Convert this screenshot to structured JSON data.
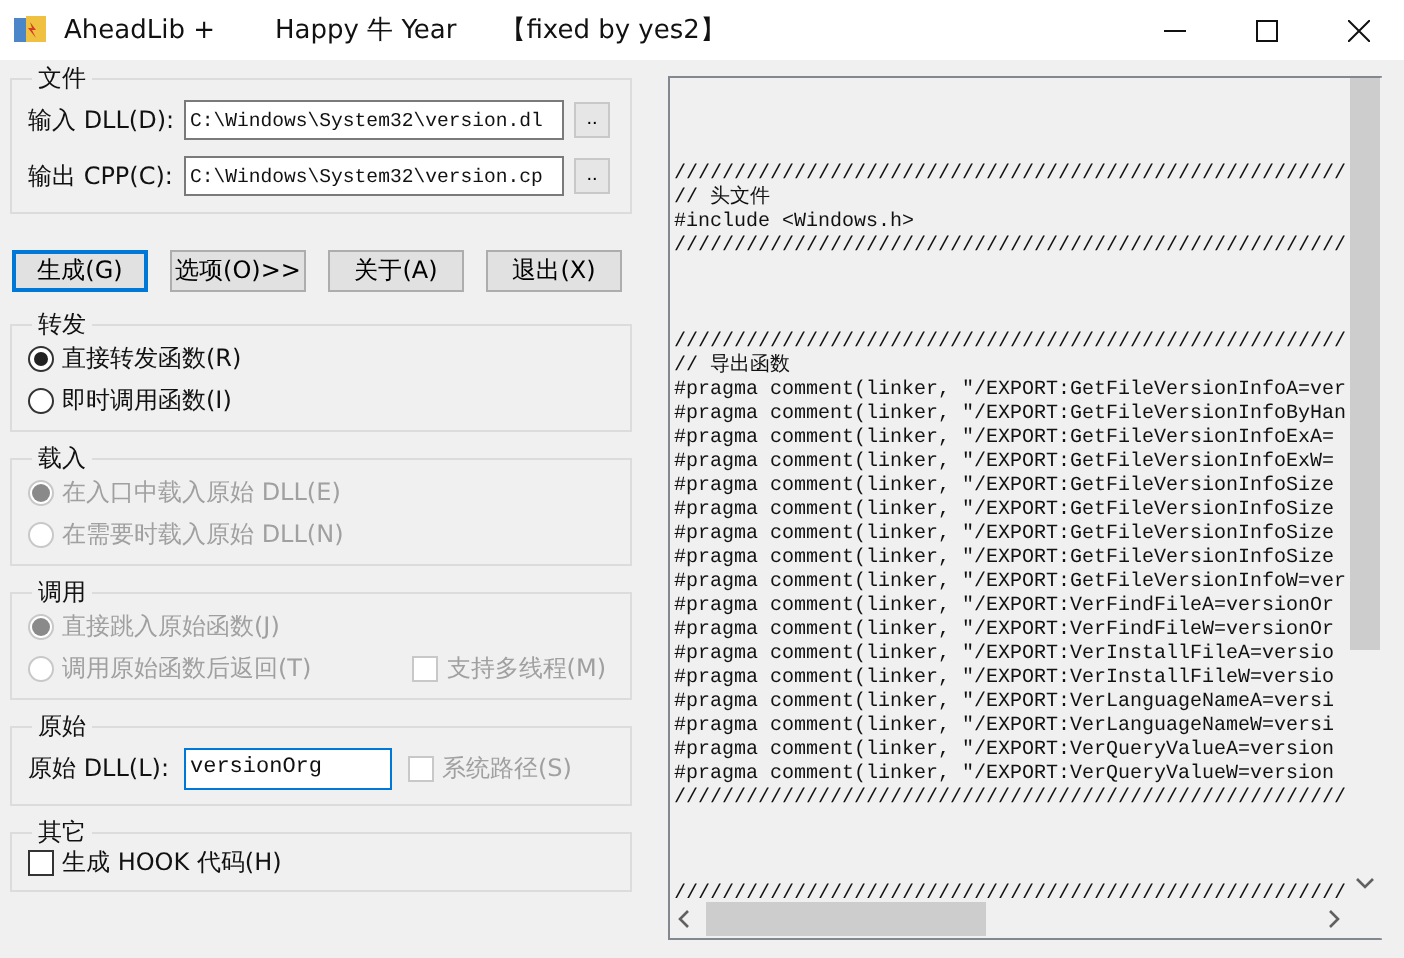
{
  "window": {
    "title_parts": [
      "AheadLib +",
      "Happy 牛 Year",
      "【fixed by yes2】"
    ]
  },
  "file_group": {
    "title": "文件",
    "rows": [
      {
        "label": "输入 DLL(D):",
        "value": "C:\\Windows\\System32\\version.dl",
        "button": ".."
      },
      {
        "label": "输出 CPP(C):",
        "value": "C:\\Windows\\System32\\version.cp",
        "button": ".."
      }
    ]
  },
  "buttons": [
    {
      "label": "生成(G)",
      "focused": true
    },
    {
      "label": "选项(O)>>",
      "focused": false
    },
    {
      "label": "关于(A)",
      "focused": false
    },
    {
      "label": "退出(X)",
      "focused": false
    }
  ],
  "forward": {
    "title": "转发",
    "options": [
      {
        "label": "直接转发函数(R)",
        "selected": true,
        "disabled": false
      },
      {
        "label": "即时调用函数(I)",
        "selected": false,
        "disabled": false
      }
    ]
  },
  "load": {
    "title": "载入",
    "options": [
      {
        "label": "在入口中载入原始 DLL(E)",
        "selected": true,
        "disabled": true
      },
      {
        "label": "在需要时载入原始 DLL(N)",
        "selected": false,
        "disabled": true
      }
    ]
  },
  "call": {
    "title": "调用",
    "options": [
      {
        "label": "直接跳入原始函数(J)",
        "selected": true,
        "disabled": true
      },
      {
        "label": "调用原始函数后返回(T)",
        "selected": false,
        "disabled": true
      }
    ],
    "checkbox": {
      "label": "支持多线程(M)",
      "checked": false,
      "disabled": true
    }
  },
  "original": {
    "title": "原始",
    "label": "原始 DLL(L):",
    "value": "versionOrg",
    "focused": true,
    "checkbox": {
      "label": "系统路径(S)",
      "checked": false,
      "disabled": true
    }
  },
  "other": {
    "title": "其它",
    "checkbox": {
      "label": "生成 HOOK 代码(H)",
      "checked": false,
      "disabled": false
    }
  },
  "code": {
    "lines": [
      {
        "kind": "blank"
      },
      {
        "kind": "blank"
      },
      {
        "kind": "blank"
      },
      {
        "kind": "code",
        "text": "////////////////////////////////////////////////////////"
      },
      {
        "kind": "code",
        "text": "// 头文件"
      },
      {
        "kind": "code",
        "text": "#include <Windows.h>"
      },
      {
        "kind": "code",
        "text": "////////////////////////////////////////////////////////"
      },
      {
        "kind": "blank"
      },
      {
        "kind": "blank"
      },
      {
        "kind": "blank"
      },
      {
        "kind": "code",
        "text": "////////////////////////////////////////////////////////"
      },
      {
        "kind": "code",
        "text": "// 导出函数"
      },
      {
        "kind": "code",
        "text": "#pragma comment(linker, \"/EXPORT:GetFileVersionInfoA=ver"
      },
      {
        "kind": "code",
        "text": "#pragma comment(linker, \"/EXPORT:GetFileVersionInfoByHan"
      },
      {
        "kind": "code",
        "text": "#pragma comment(linker, \"/EXPORT:GetFileVersionInfoExA="
      },
      {
        "kind": "code",
        "text": "#pragma comment(linker, \"/EXPORT:GetFileVersionInfoExW="
      },
      {
        "kind": "code",
        "text": "#pragma comment(linker, \"/EXPORT:GetFileVersionInfoSize"
      },
      {
        "kind": "code",
        "text": "#pragma comment(linker, \"/EXPORT:GetFileVersionInfoSize"
      },
      {
        "kind": "code",
        "text": "#pragma comment(linker, \"/EXPORT:GetFileVersionInfoSize"
      },
      {
        "kind": "code",
        "text": "#pragma comment(linker, \"/EXPORT:GetFileVersionInfoSize"
      },
      {
        "kind": "code",
        "text": "#pragma comment(linker, \"/EXPORT:GetFileVersionInfoW=ver"
      },
      {
        "kind": "code",
        "text": "#pragma comment(linker, \"/EXPORT:VerFindFileA=versionOr"
      },
      {
        "kind": "code",
        "text": "#pragma comment(linker, \"/EXPORT:VerFindFileW=versionOr"
      },
      {
        "kind": "code",
        "text": "#pragma comment(linker, \"/EXPORT:VerInstallFileA=versio"
      },
      {
        "kind": "code",
        "text": "#pragma comment(linker, \"/EXPORT:VerInstallFileW=versio"
      },
      {
        "kind": "code",
        "text": "#pragma comment(linker, \"/EXPORT:VerLanguageNameA=versi"
      },
      {
        "kind": "code",
        "text": "#pragma comment(linker, \"/EXPORT:VerLanguageNameW=versi"
      },
      {
        "kind": "code",
        "text": "#pragma comment(linker, \"/EXPORT:VerQueryValueA=version"
      },
      {
        "kind": "code",
        "text": "#pragma comment(linker, \"/EXPORT:VerQueryValueW=version"
      },
      {
        "kind": "code",
        "text": "////////////////////////////////////////////////////////"
      },
      {
        "kind": "blank"
      },
      {
        "kind": "blank"
      },
      {
        "kind": "blank"
      },
      {
        "kind": "code",
        "text": "////////////////////////////////////////////////////////"
      }
    ]
  }
}
